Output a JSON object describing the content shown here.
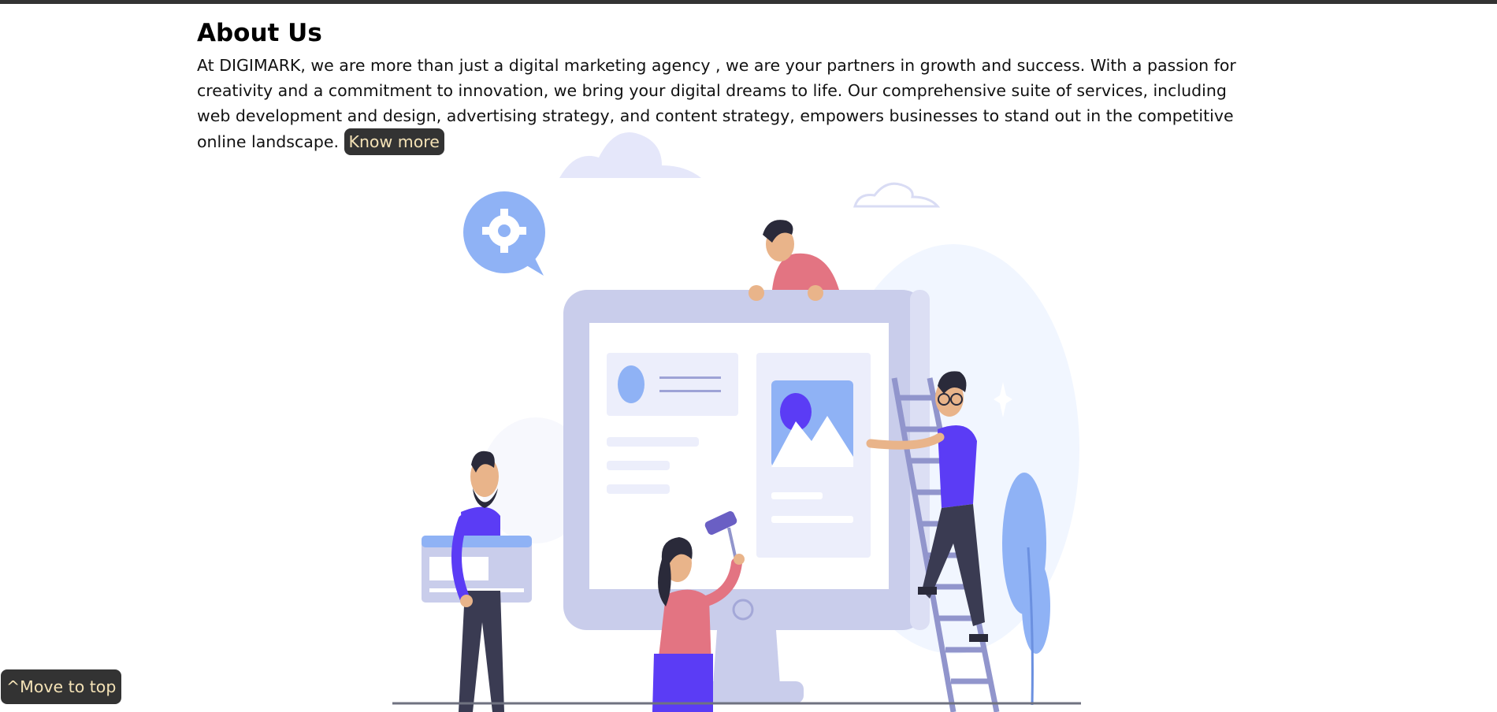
{
  "about": {
    "heading": "About Us",
    "body": "At DIGIMARK, we are more than just a digital marketing agency , we are your partners in growth and success. With a passion for creativity and a commitment to innovation, we bring your digital dreams to life. Our comprehensive suite of services, including web development and design, advertising strategy, and content strategy, empowers businesses to stand out in the competitive online landscape.",
    "know_more_label": "Know more"
  },
  "illustration": {
    "icon": "team-building-website-illustration",
    "colors": {
      "monitor": "#c9cdeb",
      "screen": "#ffffff",
      "accent_blue": "#8fb2f5",
      "purple": "#5b3cf5",
      "pink": "#e37482",
      "navy": "#3a3b52",
      "skin": "#e9b48a",
      "ladder": "#9195cc"
    }
  },
  "footer": {
    "move_top_label": "^Move to top"
  }
}
